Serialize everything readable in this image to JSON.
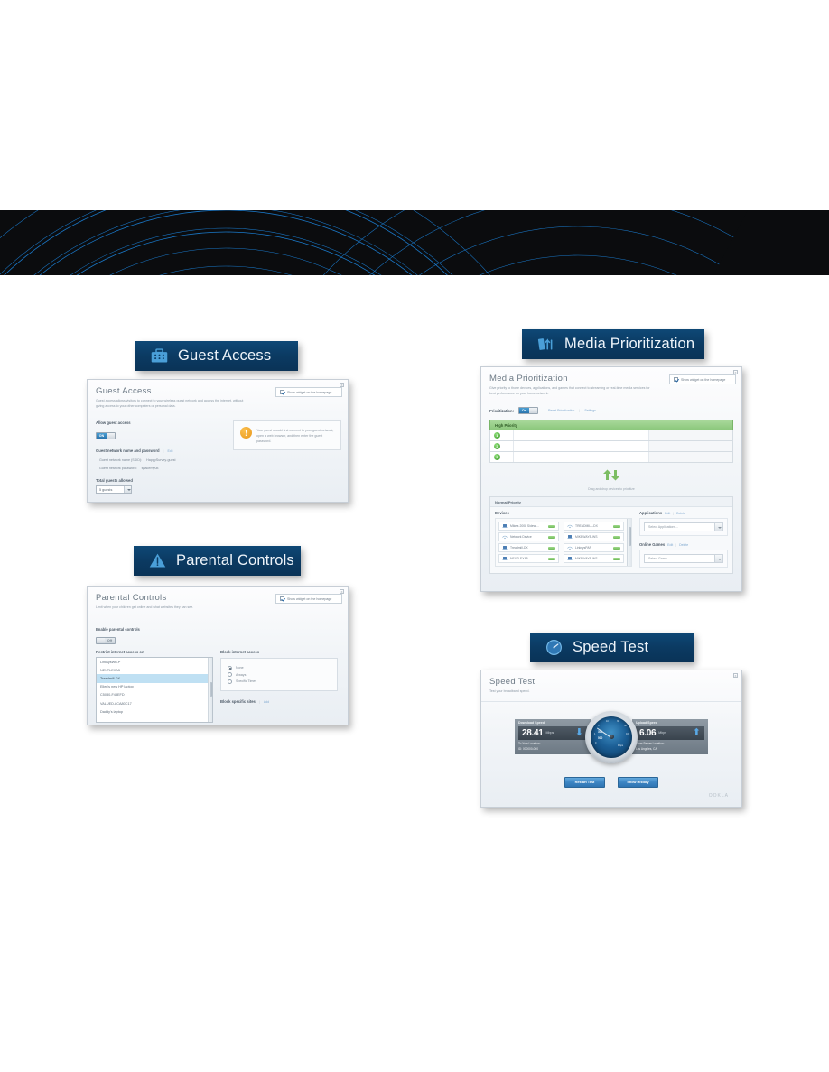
{
  "page": {
    "banner_bg": "#0b0c0e",
    "wave_color": "#1b7fd4",
    "plaque_bg": "#0b3a62"
  },
  "plaques": [
    {
      "id": "guest-access",
      "label": "Guest Access",
      "icon": "briefcase-icon"
    },
    {
      "id": "media-prioritization",
      "label": "Media Prioritization",
      "icon": "media-arrows-icon"
    },
    {
      "id": "parental-controls",
      "label": "Parental Controls",
      "icon": "warning-triangle-icon"
    },
    {
      "id": "speed-test",
      "label": "Speed Test",
      "icon": "speedometer-icon"
    }
  ],
  "guest_access": {
    "title": "Guest Access",
    "description": "Guest access allows visitors to connect to your wireless guest network and access the internet, without giving access to your other computers or personal data.",
    "widget_checkbox_label": "Show widget on the homepage",
    "allow_label": "Allow guest access",
    "toggle_state": "ON",
    "network_section_label": "Guest network name and password",
    "edit_link": "Edit",
    "ssid_label": "Guest network name (SSID):",
    "ssid_value": "HappySurvey-guest",
    "password_label": "Guest network password:",
    "password_value": "spacemy08",
    "total_guests_label": "Total guests allowed",
    "total_guests_value": "5 guests",
    "warning_text": "Your guest should first connect to your guest network, open a web browser, and then enter the guest password."
  },
  "parental_controls": {
    "title": "Parental Controls",
    "description": "Limit when your children get online and what websites they can see.",
    "widget_checkbox_label": "Show widget on the homepage",
    "enable_label": "Enable parental controls",
    "toggle_state": "Off",
    "restrict_label": "Restrict internet access on",
    "devices": [
      {
        "name": "LinksysWrt-P",
        "selected": false
      },
      {
        "name": "NEXTLEXA5",
        "selected": false
      },
      {
        "name": "Treadmill-DX",
        "selected": true
      },
      {
        "name": "Ellen's new HP laptop",
        "selected": false
      },
      {
        "name": "C5080-F43EFD",
        "selected": false
      },
      {
        "name": "VALUED-8CA80C17",
        "selected": false
      },
      {
        "name": "Daddy's laptop",
        "selected": false
      }
    ],
    "block_access_label": "Block internet access",
    "block_options": [
      {
        "label": "None",
        "selected": true
      },
      {
        "label": "Always",
        "selected": false
      },
      {
        "label": "Specific Times",
        "selected": false
      }
    ],
    "block_sites_label": "Block specific sites",
    "add_link": "Add"
  },
  "media_prioritization": {
    "title": "Media Prioritization",
    "description": "Give priority to those devices, applications, and games that connect to streaming or real-time media services for best performance on your home network.",
    "widget_checkbox_label": "Show widget on the homepage",
    "prioritization_label": "Prioritization:",
    "toggle_state": "On",
    "reset_link": "Reset Prioritization",
    "settings_link": "Settings",
    "high_priority_label": "High Priority",
    "high_priority_slots": [
      "1",
      "2",
      "3"
    ],
    "dropzone_text": "Drag and drop devices to prioritize",
    "normal_priority_label": "Normal Priority",
    "devices_label": "Devices",
    "devices_col1": [
      {
        "name": "Mike's 2008 Sidewi...",
        "icon": "laptop-icon"
      },
      {
        "name": "Network Device",
        "icon": "network-icon"
      },
      {
        "name": "Treadmill-DX",
        "icon": "laptop-icon"
      },
      {
        "name": "NEXTLEXA5",
        "icon": "laptop-icon"
      }
    ],
    "devices_col2": [
      {
        "name": "TREADMILL-DX",
        "icon": "network-icon"
      },
      {
        "name": "MIKEWAYE-WS",
        "icon": "laptop-icon"
      },
      {
        "name": "LinksysPAP",
        "icon": "network-icon"
      },
      {
        "name": "MIKEWAYE-WS",
        "icon": "laptop-icon"
      }
    ],
    "applications_label": "Applications",
    "applications_edit": "Edit",
    "applications_delete": "Delete",
    "applications_placeholder": "Select Applications...",
    "games_label": "Online Games",
    "games_edit": "Edit",
    "games_delete": "Delete",
    "games_placeholder": "Select Game..."
  },
  "speed_test": {
    "title": "Speed Test",
    "description": "Test your broadband speed.",
    "download_label": "Download Speed",
    "download_value": "28.41",
    "download_unit": "Mbps",
    "download_note_1": "To Your Location:",
    "download_note_2": "ID: 000000-000",
    "upload_label": "Upload Speed",
    "upload_value": "6.06",
    "upload_unit": "Mbps",
    "upload_note_1": "From Server Location:",
    "upload_note_2": "Los Angeles, CA",
    "gauge_ticks": [
      "0",
      "1",
      "5",
      "10",
      "30",
      "50",
      "100",
      "300",
      "500"
    ],
    "gauge_center": "Mbps",
    "restart_button": "Restart Test",
    "history_button": "Show History",
    "ookla_logo": "OOKLA"
  }
}
